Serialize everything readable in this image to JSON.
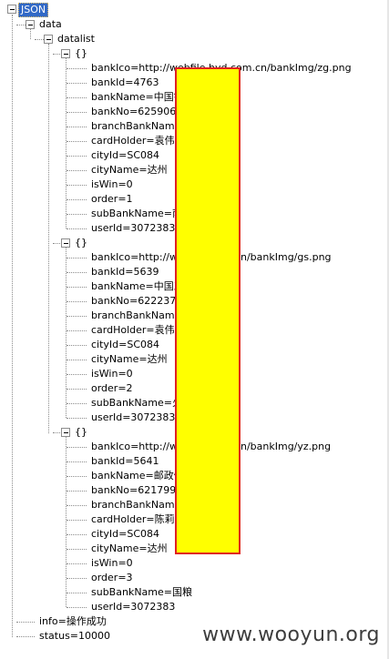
{
  "root": {
    "label": "JSON"
  },
  "data_label": "data",
  "datalist_label": "datalist",
  "items": [
    {
      "label": "{}",
      "fields": [
        "bankIco=http://webfile.hyd.com.cn/bankImg/zg.png",
        "bankId=4763",
        "bankName=中国银",
        "bankNo=62590651",
        "branchBankName=",
        "cardHolder=袁伟",
        "cityId=SC084",
        "cityName=达州",
        "isWin=0",
        "order=1",
        "subBankName=南外",
        "userId=3072383"
      ]
    },
    {
      "label": "{}",
      "fields": [
        "bankIco=http://web",
        "bankId=5639",
        "bankName=中国工",
        "bankNo=62223701",
        "branchBankName=",
        "cardHolder=袁伟",
        "cityId=SC084",
        "cityName=达州",
        "isWin=0",
        "order=2",
        "subBankName=火车",
        "userId=3072383"
      ],
      "ico_suffix": "n/bankImg/gs.png"
    },
    {
      "label": "{}",
      "fields": [
        "bankIco=http://web",
        "bankId=5641",
        "bankName=邮政储",
        "bankNo=62179967",
        "branchBankName=",
        "cardHolder=陈莉",
        "cityId=SC084",
        "cityName=达州",
        "isWin=0",
        "order=3",
        "subBankName=国粮",
        "userId=3072383"
      ],
      "ico_suffix": "n/bankImg/yz.png"
    }
  ],
  "info": "info=操作成功",
  "status": "status=10000",
  "watermark": "www.wooyun.org",
  "colors": {
    "selection": "#3169c6",
    "redaction_fill": "#ffff00",
    "redaction_border": "#e02020"
  }
}
